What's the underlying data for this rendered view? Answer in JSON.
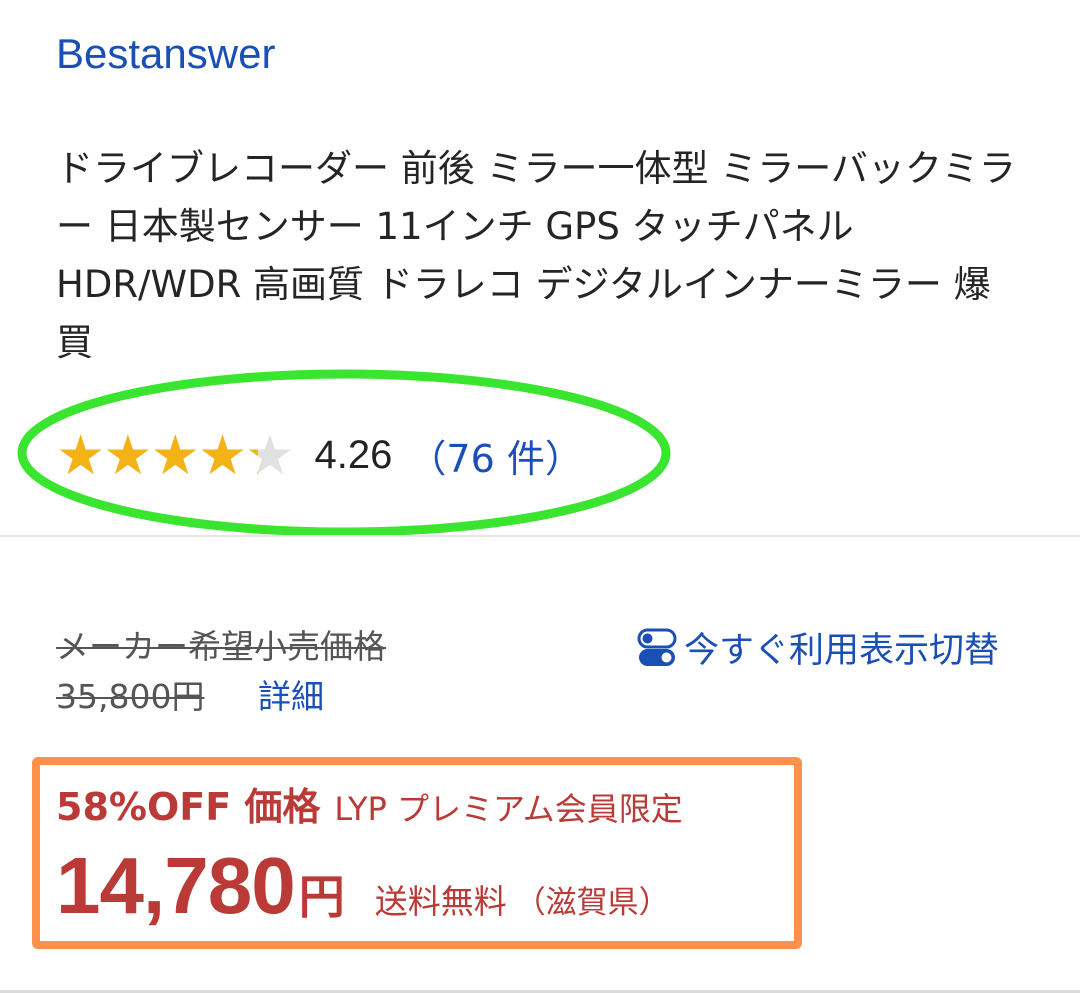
{
  "store": {
    "name": "Bestanswer"
  },
  "product": {
    "title": "ドライブレコーダー 前後 ミラー一体型  ミラーバックミラー 日本製センサー 11インチ GPS タッチパネル HDR/WDR 高画質 ドラレコ デジタルインナーミラー 爆買"
  },
  "rating": {
    "stars": 4.26,
    "value": "4.26",
    "reviews": "（76 件）",
    "star_color": "#f3b316",
    "icon": "star-icon"
  },
  "pricing": {
    "list_price_label": "メーカー希望小売価格",
    "list_price": "35,800円",
    "details_link": "詳細",
    "toggle_label": "今すぐ利用表示切替",
    "toggle_icon": "toggle-icon",
    "discount_label": "58%OFF 価格",
    "member_label": "LYP プレミアム会員限定",
    "sale_price": "14,780",
    "currency": "円",
    "shipping": "送料無料",
    "shipping_region": "（滋賀県）",
    "accent_color": "#b93a36",
    "link_color": "#1a4fb5"
  },
  "annotations": {
    "rating_highlight_color": "#39e52f",
    "price_highlight_color": "#ff914d"
  }
}
